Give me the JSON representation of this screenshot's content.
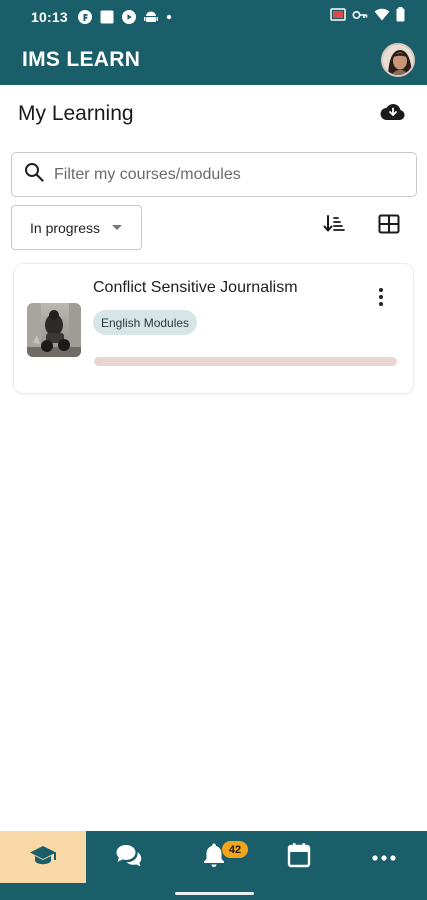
{
  "status_bar": {
    "time": "10:13",
    "left_icons": [
      "f-logo-icon",
      "square-icon",
      "play-icon",
      "android-icon",
      "dot-icon"
    ],
    "right_icons": [
      "cast-icon",
      "key-icon",
      "wifi-icon",
      "battery-icon"
    ]
  },
  "app_bar": {
    "title": "IMS LEARN",
    "avatar": "user-avatar"
  },
  "header": {
    "title": "My Learning",
    "download_icon": "cloud-download-icon"
  },
  "search": {
    "placeholder": "Filter my courses/modules",
    "value": ""
  },
  "filter": {
    "selected": "In progress",
    "sort_icon": "sort-icon",
    "view_icon": "grid-view-icon"
  },
  "courses": [
    {
      "title": "Conflict Sensitive Journalism",
      "tag": "English Modules",
      "progress": 0
    }
  ],
  "bottom_nav": {
    "items": [
      "graduation-cap-icon",
      "chat-icon",
      "bell-icon",
      "calendar-icon",
      "more-icon"
    ],
    "badge": "42",
    "active_index": 0
  },
  "colors": {
    "primary": "#195e68",
    "active_tab": "#f9d8a7",
    "badge": "#f2a41a",
    "tag_bg": "#d7e5e6",
    "progress_track": "#e7d6d1"
  }
}
